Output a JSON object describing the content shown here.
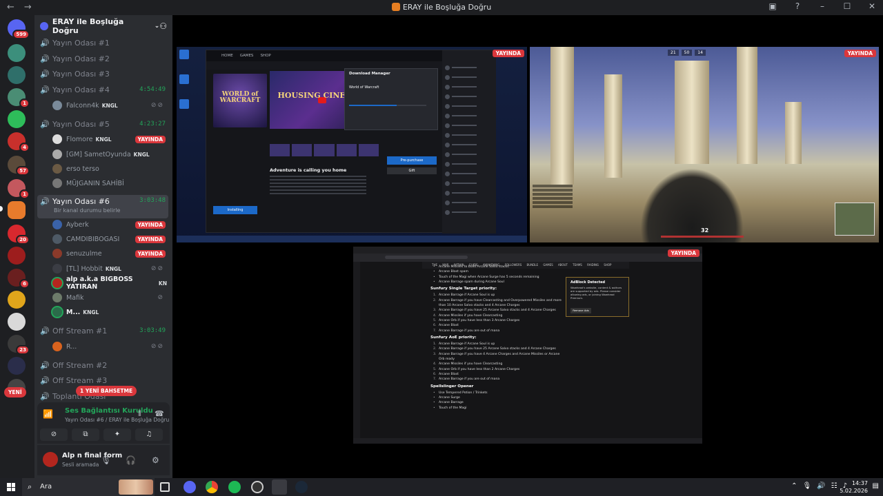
{
  "window": {
    "title": "ERAY ile Boşluğa Doğru",
    "back": "←",
    "forward": "→"
  },
  "rail": {
    "home_badge": "599",
    "badges": [
      "1",
      "4",
      "57",
      "1",
      "20",
      "6",
      "23"
    ],
    "new_label": "YENİ"
  },
  "server": {
    "name": "ERAY ile Boşluğa Doğru"
  },
  "channels": {
    "c1": "Yayın Odası #1",
    "c2": "Yayın Odası #2",
    "c3": "Yayın Odası #3",
    "c4": {
      "name": "Yayın Odası #4",
      "time": "4:54:49"
    },
    "c4_users": [
      {
        "name": "Falconn4k",
        "tag": "KNGL"
      }
    ],
    "c5": {
      "name": "Yayın Odası #5",
      "time": "4:23:27"
    },
    "c5_users": [
      {
        "name": "Flomore",
        "tag": "KNGL",
        "live": "YAYINDA"
      },
      {
        "name": "[GM] SametOyunda",
        "tag": "KNGL"
      },
      {
        "name": "erso terso"
      },
      {
        "name": "MÜJGANIN SAHİBİ"
      }
    ],
    "c6": {
      "name": "Yayın Odası #6",
      "time": "3:03:48",
      "status": "Bir kanal durumu belirle"
    },
    "c6_users": [
      {
        "name": "Ayberk",
        "live": "YAYINDA"
      },
      {
        "name": "CAMDIBIBOGASI",
        "live": "YAYINDA"
      },
      {
        "name": "senuzulme",
        "live": "YAYINDA"
      },
      {
        "name": "[TL] Hobbit",
        "tag": "KNGL"
      },
      {
        "name": "alp a.k.a BIGBOSS YATIRAN",
        "tag": "KN"
      },
      {
        "name": "Mafik"
      },
      {
        "name": "M...",
        "tag": "KNGL"
      }
    ],
    "off1": {
      "name": "Off Stream #1",
      "time": "3:03:49"
    },
    "off1_users": [
      {
        "name": "R..."
      }
    ],
    "off2": "Off Stream #2",
    "off3": "Off Stream #3",
    "meeting": "Toplantı Odası",
    "mention_pill": "1 YENİ BAHSETME"
  },
  "voice": {
    "title": "Ses Bağlantısı Kuruldu",
    "sub": "Yayın Odası #6 / ERAY ile Boşluğa Doğru"
  },
  "user": {
    "name": "Alp n final form",
    "status": "Sesli aramada"
  },
  "streams": {
    "live_label": "YAYINDA",
    "launcher": {
      "nav": [
        "HOME",
        "GAMES",
        "SHOP"
      ],
      "game_logo": "WORLD of WARCRAFT",
      "hero_text": "HOUSING CINEMATIC",
      "adventure": "Adventure is calling you home",
      "install": "Installing",
      "download_manager": "Download Manager",
      "dm_game": "World of Warcraft",
      "dm_progress": 0.62,
      "preorder": "Pre-purchase",
      "gift": "Gift"
    },
    "game": {
      "hud": [
        "21",
        "50",
        "14"
      ],
      "ammo": "32"
    },
    "guide": {
      "menu": "THE WAR WITHIN   GUIDE AWAKENING   FOLLOWERS   BUNDLE   GAMES   ABOUT   TEAMS   RAIDING   SHOP",
      "intro_lines": [
        "Arcane Missiles to build Arcane Salvo stacks",
        "Arcane Blast spam",
        "Touch of the Magi when Arcane Surge has 5 seconds remaining",
        "Arcane Barrage spam during Arcane Soul"
      ],
      "h1": "Sunfury Single Target priority:",
      "st": [
        "Arcane Barrage if Arcane Soul is up",
        "Arcane Barrage if you have Clearcasting and Overpowered Missiles and more than 10 Arcane Salvo stacks and 4 Arcane Charges",
        "Arcane Barrage if you have 25 Arcane Salvo stacks and 4 Arcane Charges",
        "Arcane Missiles if you have Clearcasting",
        "Arcane Orb if you have less than 3 Arcane Charges",
        "Arcane Blast",
        "Arcane Barrage if you are out of mana"
      ],
      "h2": "Sunfury AoE priority:",
      "aoe": [
        "Arcane Barrage if Arcane Soul is up",
        "Arcane Barrage if you have 25 Arcane Salvo stacks and 4 Arcane Charges",
        "Arcane Barrage if you have 4 Arcane Charges and Arcane Missiles or Arcane Orb ready",
        "Arcane Missiles if you have Clearcasting",
        "Arcane Orb if you have less than 2 Arcane Charges",
        "Arcane Blast",
        "Arcane Barrage if you are out of mana"
      ],
      "h3": "Spellslinger Opener",
      "opener": [
        "Use Tempered Potion / Trinkets",
        "Arcane Surge",
        "Arcane Barrage",
        "Touch of the Magi"
      ],
      "ad_title": "AdBlock Detected",
      "ad_body": "Wowhead's website, content & authors are supported by ads. Please consider allowing ads, or joining Wowhead Premium.",
      "ad_button": "Remove Ads"
    }
  },
  "taskbar": {
    "search": "Ara",
    "time": "14:37",
    "date": "5.02.2026",
    "notifications": "3"
  }
}
